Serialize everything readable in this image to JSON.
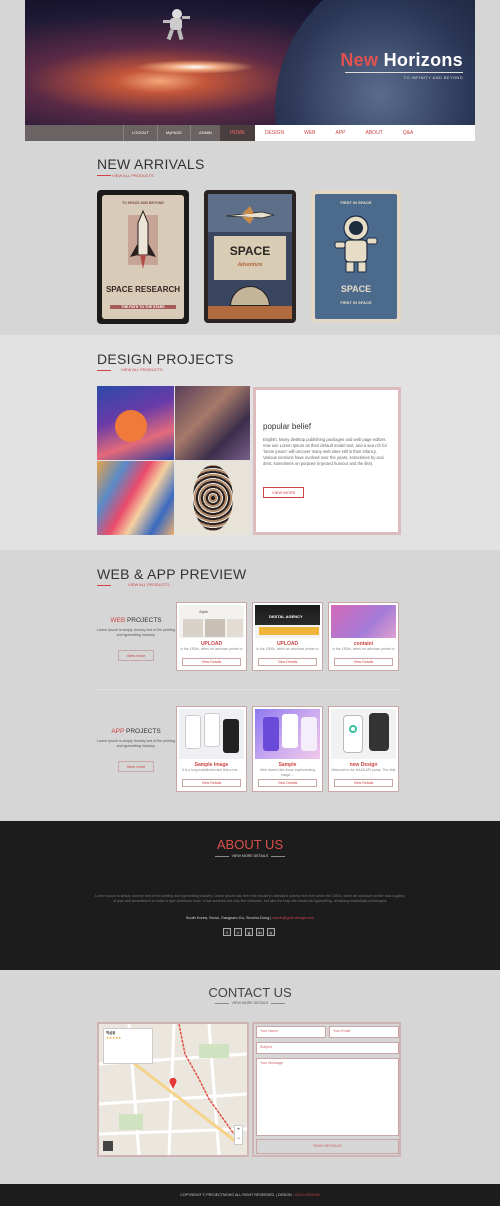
{
  "hero": {
    "title_accent": "New",
    "title_rest": "Horizons",
    "subtitle": "TO INFINITY AND BEYOND"
  },
  "nav": {
    "account": [
      "LOGOUT",
      "MyPAGE",
      "ADMIN"
    ],
    "menu": [
      "HOME",
      "DESIGN",
      "WEB",
      "APP",
      "ABOUT",
      "Q&A"
    ]
  },
  "arrivals": {
    "title": "NEW ARRIVALS",
    "view_all": "VIEW ALL PRODUCTS",
    "posters": [
      {
        "top": "TO SPACE AND BEYOND",
        "big": "SPACE RESEARCH",
        "bottom": "THE PATH TO THE STARS"
      },
      {
        "big": "SPACE",
        "script": "Adventure"
      },
      {
        "top": "FIRST IN SPACE",
        "big": "SPACE",
        "bottom": "FIRST IN SPACE"
      }
    ]
  },
  "design": {
    "title": "DESIGN PROJECTS",
    "view_all": "VIEW ALL PRODUCTS",
    "feature_title": "popular belief",
    "feature_text": "English. Many desktop publishing packages and web page editors now use Lorem Ipsum as their default model text, and a sea rch for 'lorem ipsum' will uncover many web sites still in their infancy. Various versions have evolved over the years, sometimes by acci",
    "feature_text2": "dent, sometimes on purpose (injected humour and the like).",
    "feature_button": "VIEW MORE"
  },
  "webapp": {
    "title": "WEB & APP PREVIEW",
    "view_all": "VIEW ALL PRODUCTS",
    "web": {
      "label_accent": "WEB",
      "label_rest": " PROJECTS",
      "desc": "Lorem Ipsum is simply dummy text of the printing and typesetting industry.",
      "button": "View more",
      "cards": [
        {
          "title": "UPLOAD",
          "desc": "in the 1500s, when an unknown printer to ...",
          "button": "View Details"
        },
        {
          "title": "UPLOAD",
          "desc": "in the 1500s, when an unknown printer to ...",
          "button": "View Details"
        },
        {
          "title": "containi",
          "desc": "in the 1500s, when an unknown printer to ...",
          "button": "View Details"
        }
      ]
    },
    "app": {
      "label_accent": "APP",
      "label_rest": " PROJECTS",
      "desc": "Lorem Ipsum is simply dummy text of the printing and typesetting industry.",
      "button": "View more",
      "cards": [
        {
          "title": "Sample Image",
          "desc": "It is a long established fact that a rea ...",
          "button": "View Details"
        },
        {
          "title": "Sample",
          "desc": "Web doesn't like those implementing image ...",
          "button": "View Details"
        },
        {
          "title": "new Design",
          "desc": "Welcome to the NASA API portal. The obje ...",
          "button": "View Details"
        }
      ]
    }
  },
  "about": {
    "title": "ABOUT US",
    "sub": "VIEW MORE DETAILS",
    "text": "Lorem Ipsum is simply dummy text of the printing and typesetting industry. Lorem Ipsum has been the industry's standard dummy text ever since the 1500s, when an unknown printer took a galley of type and scrambled it to make a type specimen book. It has survived not only five centuries, but also the leap into electronic typesetting, remaining essentially unchanged.",
    "address": "South Korea, Seoul, Gangnam-Gu, Seocho-Dong",
    "email": "admin@gold.design.com",
    "socials": [
      "f",
      "t",
      "g",
      "in",
      "y"
    ]
  },
  "contact": {
    "title": "CONTACT US",
    "sub": "VIEW MORE DETAILS",
    "name_placeholder": "Your Name",
    "email_placeholder": "Your Email",
    "subject_placeholder": "Subject",
    "message_placeholder": "Your Message",
    "send": "SEND MESSAGE",
    "map_place": "역삼동"
  },
  "footer": {
    "copyright": "COPYRIGHT © PROJECTMOHG ALL RIGHT RESERVED.",
    "design_label": "DESIGN",
    "design_value": "GOLD DESIGN"
  },
  "colors": {
    "accent": "#cc4444",
    "dark": "#1c1c1c"
  }
}
